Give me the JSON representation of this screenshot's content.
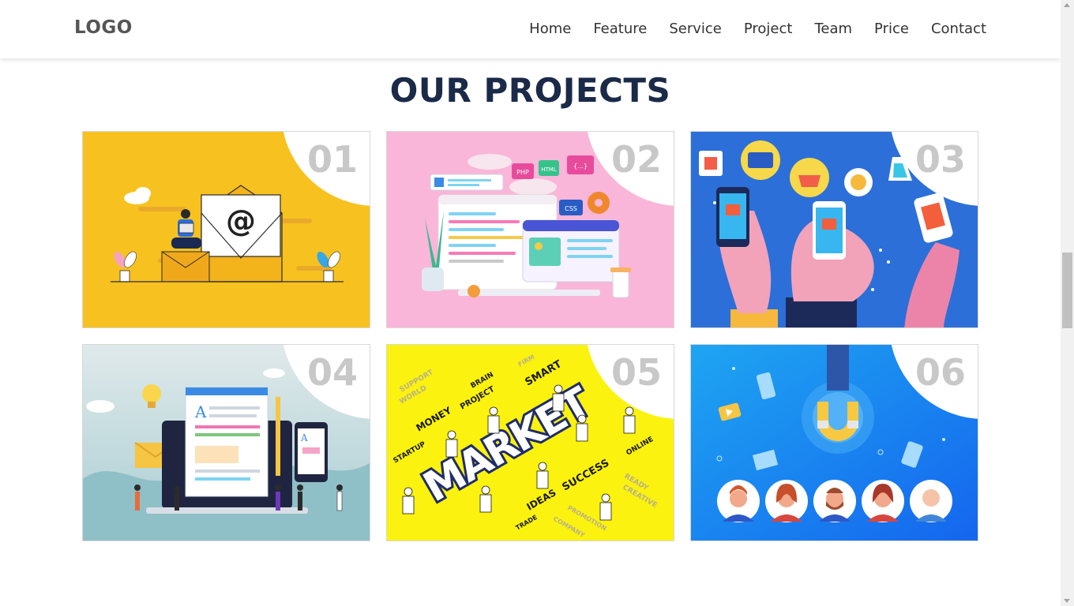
{
  "header": {
    "logo": "LOGO",
    "nav": [
      "Home",
      "Feature",
      "Service",
      "Project",
      "Team",
      "Price",
      "Contact"
    ]
  },
  "projects": {
    "title": "OUR PROJECTS",
    "items": [
      {
        "number": "01",
        "image": "email-marketing-illustration",
        "bg": "#f7c21f"
      },
      {
        "number": "02",
        "image": "web-development-illustration",
        "bg": "#f9b6d8"
      },
      {
        "number": "03",
        "image": "mobile-shopping-illustration",
        "bg": "#2c6fd8"
      },
      {
        "number": "04",
        "image": "content-writing-illustration",
        "bg": "#a9ced3"
      },
      {
        "number": "05",
        "image": "market-concept-illustration",
        "bg": "#fbf20f"
      },
      {
        "number": "06",
        "image": "customer-magnet-illustration",
        "bg": "#1a86f0"
      }
    ],
    "art_text": {
      "at": "@",
      "php": "PHP",
      "html": "HTML",
      "braces": "{...}",
      "css": "CSS",
      "letter_a": "A",
      "market": "MARKET",
      "money": "MONEY",
      "project": "PROJECT",
      "brain": "BRAIN",
      "smart": "SMART",
      "online": "ONLINE",
      "success": "SUCCESS",
      "ideas": "IDEAS",
      "startup": "STARTUP",
      "support": "SUPPORT",
      "world": "WORLD",
      "firm": "FIRM",
      "trade": "TRADE",
      "promotion": "PROMOTION",
      "company": "COMPANY",
      "ready": "READY",
      "creative": "CREATIVE"
    }
  }
}
